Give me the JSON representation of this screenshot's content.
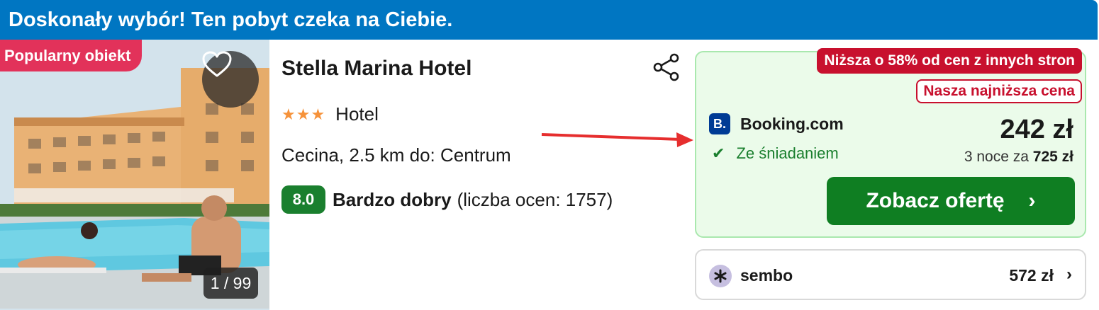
{
  "banner": {
    "text": "Doskonały wybór! Ten pobyt czeka na Ciebie."
  },
  "photo": {
    "badge": "Popularny obiekt",
    "counter": "1 / 99",
    "favorite_icon": "heart-icon"
  },
  "hotel": {
    "name": "Stella Marina Hotel",
    "stars": "★★★",
    "type": "Hotel",
    "location": "Cecina, 2.5 km do: Centrum",
    "rating_score": "8.0",
    "rating_label": "Bardzo dobry",
    "rating_count": "(liczba ocen: 1757)",
    "share_icon": "share-icon"
  },
  "deal": {
    "badge_lower": "Niższa o 58% od cen z innych stron",
    "badge_lowest": "Nasza najniższa cena",
    "provider_logo": "B.",
    "provider_name": "Booking.com",
    "breakfast": "Ze śniadaniem",
    "price": "242 zł",
    "total_prefix": "3 noce za",
    "total_value": "725 zł",
    "cta_label": "Zobacz ofertę",
    "cta_chevron": "›"
  },
  "alternative": {
    "provider_name": "sembo",
    "price": "572 zł",
    "chevron": "›"
  },
  "colors": {
    "banner": "#0076c2",
    "popular_badge": "#e2325a",
    "rating": "#1a7f2e",
    "deal_bg": "#ebfbea",
    "deal_border": "#a9e8ae",
    "badge_red": "#c8102e",
    "cta": "#0f7e22",
    "booking_blue": "#003b95",
    "stars": "#f6923a",
    "arrow": "#e62e2e"
  }
}
